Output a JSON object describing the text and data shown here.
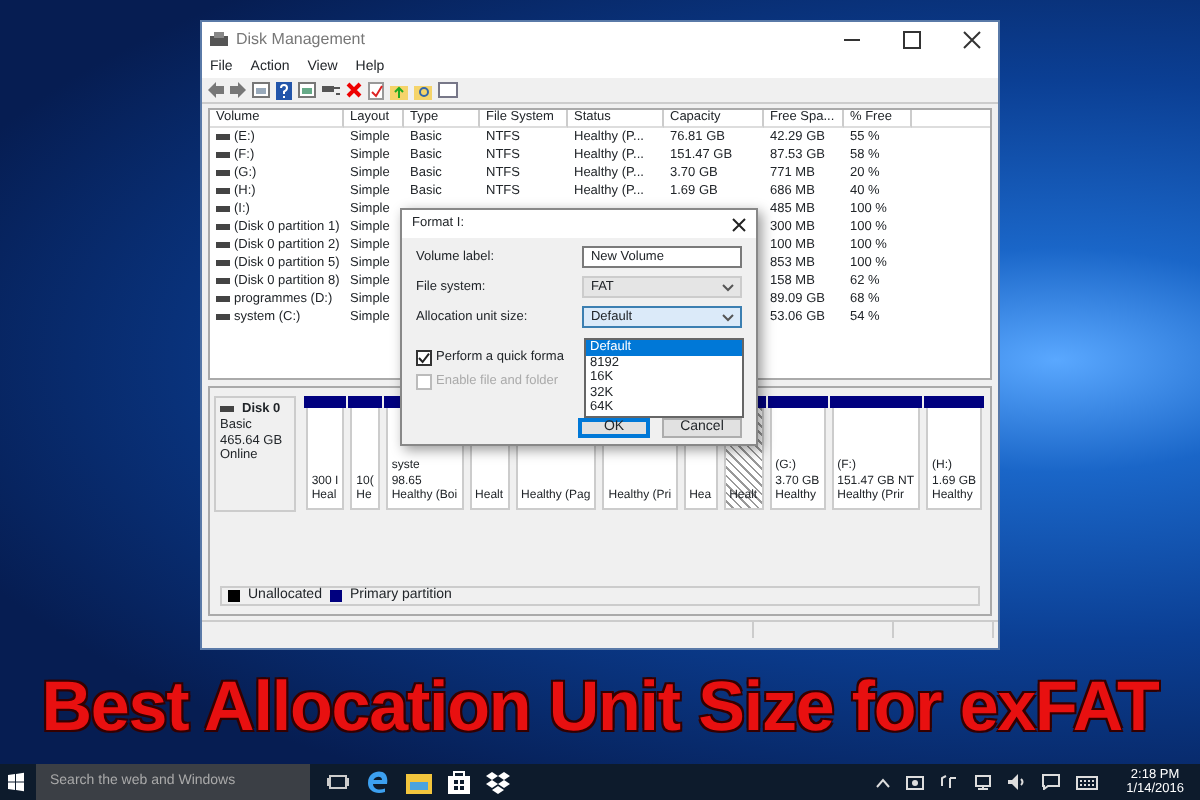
{
  "window": {
    "title": "Disk Management"
  },
  "menu": [
    "File",
    "Action",
    "View",
    "Help"
  ],
  "volumes": {
    "columns": [
      "Volume",
      "Layout",
      "Type",
      "File System",
      "Status",
      "Capacity",
      "Free Spa...",
      "% Free"
    ],
    "rows": [
      {
        "volume": "(E:)",
        "layout": "Simple",
        "type": "Basic",
        "file_system": "NTFS",
        "status": "Healthy (P...",
        "capacity": "76.81 GB",
        "free_space": "42.29 GB",
        "percent_free": "55 %"
      },
      {
        "volume": "(F:)",
        "layout": "Simple",
        "type": "Basic",
        "file_system": "NTFS",
        "status": "Healthy (P...",
        "capacity": "151.47 GB",
        "free_space": "87.53 GB",
        "percent_free": "58 %"
      },
      {
        "volume": "(G:)",
        "layout": "Simple",
        "type": "Basic",
        "file_system": "NTFS",
        "status": "Healthy (P...",
        "capacity": "3.70 GB",
        "free_space": "771 MB",
        "percent_free": "20 %"
      },
      {
        "volume": "(H:)",
        "layout": "Simple",
        "type": "Basic",
        "file_system": "NTFS",
        "status": "Healthy (P...",
        "capacity": "1.69 GB",
        "free_space": "686 MB",
        "percent_free": "40 %"
      },
      {
        "volume": "(I:)",
        "layout": "Simple",
        "free_space": "485 MB",
        "percent_free": "100 %"
      },
      {
        "volume": "(Disk 0 partition 1)",
        "layout": "Simple",
        "free_space": "300 MB",
        "percent_free": "100 %"
      },
      {
        "volume": "(Disk 0 partition 2)",
        "layout": "Simple",
        "free_space": "100 MB",
        "percent_free": "100 %"
      },
      {
        "volume": "(Disk 0 partition 5)",
        "layout": "Simple",
        "free_space": "853 MB",
        "percent_free": "100 %"
      },
      {
        "volume": "(Disk 0 partition 8)",
        "layout": "Simple",
        "free_space": "158 MB",
        "percent_free": "62 %"
      },
      {
        "volume": "programmes (D:)",
        "layout": "Simple",
        "free_space": "89.09 GB",
        "percent_free": "68 %"
      },
      {
        "volume": "system (C:)",
        "layout": "Simple",
        "free_space": "53.06 GB",
        "percent_free": "54 %"
      }
    ]
  },
  "disk": {
    "name": "Disk 0",
    "type": "Basic",
    "size": "465.64 GB",
    "state": "Online",
    "partitions": [
      {
        "lines": [
          "300 I",
          "Heal"
        ],
        "selected": false
      },
      {
        "lines": [
          "10(",
          "He"
        ],
        "selected": false
      },
      {
        "lines": [
          "syste",
          "98.65",
          "Healthy (Boi"
        ],
        "selected": false
      },
      {
        "lines": [
          "Healt"
        ],
        "selected": false
      },
      {
        "lines": [
          "Healthy (Pag"
        ],
        "selected": false
      },
      {
        "lines": [
          "Healthy (Pri"
        ],
        "selected": false
      },
      {
        "lines": [
          "Hea"
        ],
        "selected": false
      },
      {
        "lines": [
          "Healt"
        ],
        "selected": true
      },
      {
        "lines": [
          "(G:)",
          "3.70 GB",
          "Healthy"
        ],
        "selected": false
      },
      {
        "lines": [
          "(F:)",
          "151.47 GB NT",
          "Healthy (Prir"
        ],
        "selected": false
      },
      {
        "lines": [
          "(H:)",
          "1.69 GB",
          "Healthy"
        ],
        "selected": false
      }
    ]
  },
  "legend": [
    {
      "label": "Unallocated",
      "color": "#000000"
    },
    {
      "label": "Primary partition",
      "color": "#00007f"
    }
  ],
  "dialog": {
    "title": "Format I:",
    "fields": [
      {
        "label": "Volume label:",
        "value": "New Volume",
        "kind": "text",
        "disabled": false
      },
      {
        "label": "File system:",
        "value": "FAT",
        "kind": "select",
        "disabled": true
      },
      {
        "label": "Allocation unit size:",
        "value": "Default",
        "kind": "select",
        "disabled": false
      }
    ],
    "dropdown": [
      {
        "label": "Default",
        "selected": true
      },
      {
        "label": "8192",
        "selected": false
      },
      {
        "label": "16K",
        "selected": false
      },
      {
        "label": "32K",
        "selected": false
      },
      {
        "label": "64K",
        "selected": false
      }
    ],
    "options": [
      {
        "label": "Perform a quick forma",
        "checked": true,
        "disabled": false
      },
      {
        "label": "Enable file and folder",
        "checked": false,
        "disabled": true
      }
    ],
    "buttons": [
      {
        "label": "OK",
        "default": true
      },
      {
        "label": "Cancel",
        "default": false
      }
    ]
  },
  "headline": "Best Allocation Unit Size for exFAT",
  "taskbar": {
    "search": {
      "placeholder": "Search the web and Windows"
    },
    "time": "2:18 PM",
    "date": "1/14/2016"
  }
}
